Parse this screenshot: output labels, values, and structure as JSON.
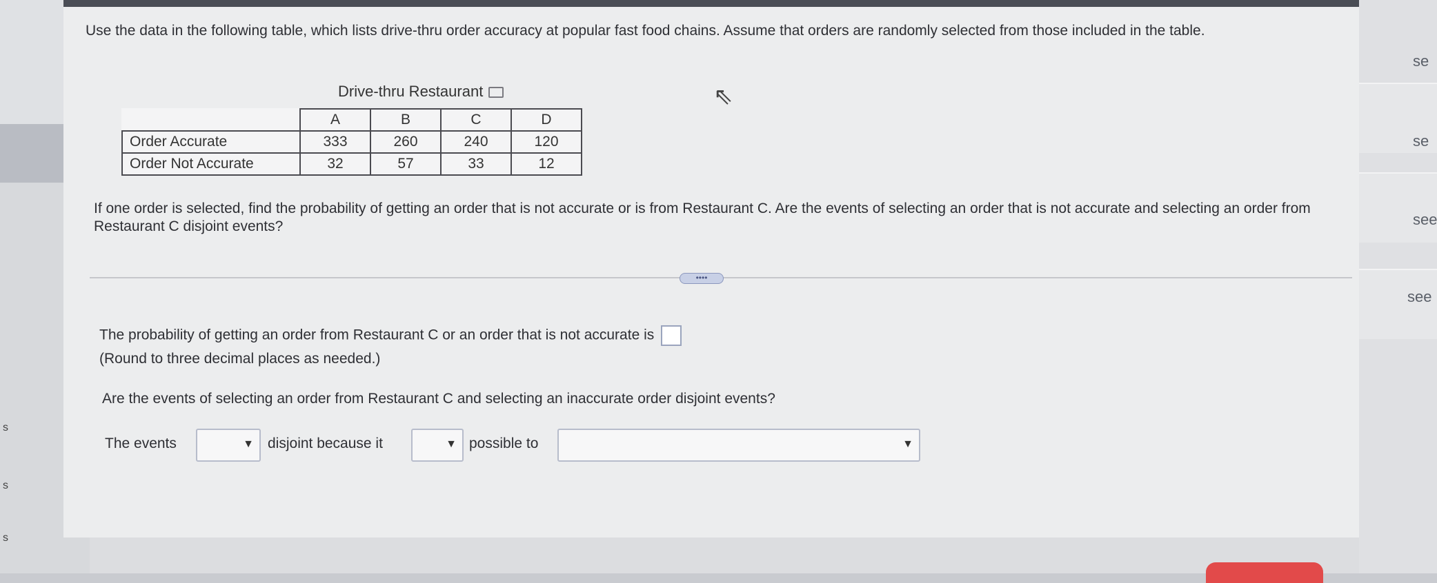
{
  "intro": "Use the data in the following table, which lists drive-thru order accuracy at popular fast food chains. Assume that orders are randomly selected from those included in the table.",
  "table": {
    "title": "Drive-thru Restaurant",
    "columns": [
      "A",
      "B",
      "C",
      "D"
    ],
    "rows": [
      {
        "label": "Order Accurate",
        "values": [
          "333",
          "260",
          "240",
          "120"
        ]
      },
      {
        "label": "Order Not Accurate",
        "values": [
          "32",
          "57",
          "33",
          "12"
        ]
      }
    ]
  },
  "question": "If one order is selected, find the probability of getting an order that is not accurate or is from Restaurant C. Are the events of selecting an order that is not accurate and selecting an order from Restaurant C disjoint events?",
  "more_button": "••••",
  "answer": {
    "probability_prompt": "The probability of getting an order from Restaurant C or an order that is not accurate is",
    "probability_value": "",
    "round_note": "(Round to three decimal places as needed.)",
    "disjoint_question": "Are the events of selecting an order from Restaurant C and selecting an inaccurate order disjoint events?",
    "sentence": {
      "part1": "The events",
      "part2": "disjoint because it",
      "part3": "possible to"
    },
    "dropdown1_value": "",
    "dropdown2_value": "",
    "dropdown3_value": ""
  },
  "right_links": [
    "se",
    "se",
    "see",
    "see"
  ],
  "gutter_marks": [
    "s",
    "s",
    "s"
  ]
}
